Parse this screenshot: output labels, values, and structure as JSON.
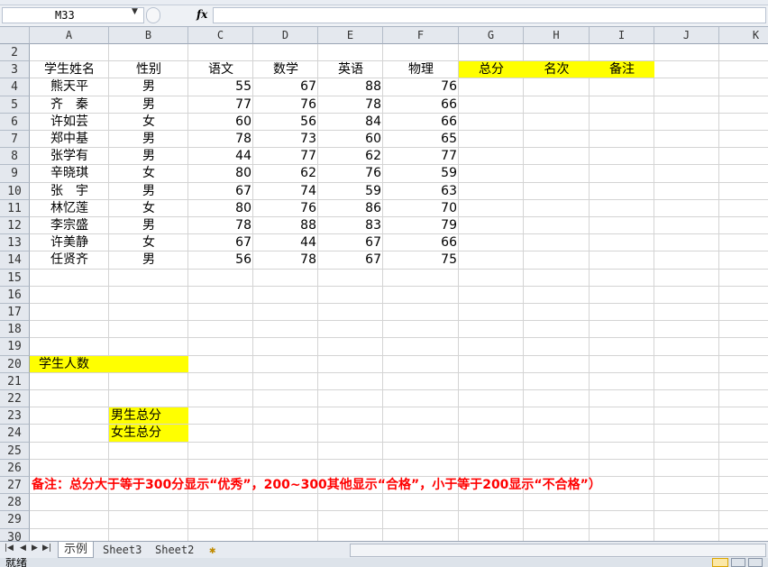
{
  "formula_bar": {
    "name_box": "M33",
    "fx_label": "fx",
    "formula": ""
  },
  "columns": [
    "A",
    "B",
    "C",
    "D",
    "E",
    "F",
    "G",
    "H",
    "I",
    "J",
    "K"
  ],
  "row_numbers": [
    "2",
    "3",
    "4",
    "5",
    "6",
    "7",
    "8",
    "9",
    "10",
    "11",
    "12",
    "13",
    "14",
    "15",
    "16",
    "17",
    "18",
    "19",
    "20",
    "21",
    "22",
    "23",
    "24",
    "25",
    "26",
    "27",
    "28",
    "29",
    "30"
  ],
  "highlight_color": "#FFFF00",
  "note_color": "#FF0000",
  "cells": [
    {
      "col": "A",
      "row": 3,
      "text": "学生姓名"
    },
    {
      "col": "B",
      "row": 3,
      "text": "性别"
    },
    {
      "col": "C",
      "row": 3,
      "text": "语文"
    },
    {
      "col": "D",
      "row": 3,
      "text": "数学"
    },
    {
      "col": "E",
      "row": 3,
      "text": "英语"
    },
    {
      "col": "F",
      "row": 3,
      "text": "物理"
    },
    {
      "col": "G",
      "row": 3,
      "text": "总分",
      "fill": true
    },
    {
      "col": "H",
      "row": 3,
      "text": "名次",
      "fill": true
    },
    {
      "col": "I",
      "row": 3,
      "text": "备注",
      "fill": true
    },
    {
      "col": "A",
      "row": 4,
      "text": "熊天平"
    },
    {
      "col": "B",
      "row": 4,
      "text": "男"
    },
    {
      "col": "C",
      "row": 4,
      "text": "55",
      "num": true
    },
    {
      "col": "D",
      "row": 4,
      "text": "67",
      "num": true
    },
    {
      "col": "E",
      "row": 4,
      "text": "88",
      "num": true
    },
    {
      "col": "F",
      "row": 4,
      "text": "76",
      "num": true
    },
    {
      "col": "A",
      "row": 5,
      "text": "齐　秦"
    },
    {
      "col": "B",
      "row": 5,
      "text": "男"
    },
    {
      "col": "C",
      "row": 5,
      "text": "77",
      "num": true
    },
    {
      "col": "D",
      "row": 5,
      "text": "76",
      "num": true
    },
    {
      "col": "E",
      "row": 5,
      "text": "78",
      "num": true
    },
    {
      "col": "F",
      "row": 5,
      "text": "66",
      "num": true
    },
    {
      "col": "A",
      "row": 6,
      "text": "许如芸"
    },
    {
      "col": "B",
      "row": 6,
      "text": "女"
    },
    {
      "col": "C",
      "row": 6,
      "text": "60",
      "num": true
    },
    {
      "col": "D",
      "row": 6,
      "text": "56",
      "num": true
    },
    {
      "col": "E",
      "row": 6,
      "text": "84",
      "num": true
    },
    {
      "col": "F",
      "row": 6,
      "text": "66",
      "num": true
    },
    {
      "col": "A",
      "row": 7,
      "text": "郑中基"
    },
    {
      "col": "B",
      "row": 7,
      "text": "男"
    },
    {
      "col": "C",
      "row": 7,
      "text": "78",
      "num": true
    },
    {
      "col": "D",
      "row": 7,
      "text": "73",
      "num": true
    },
    {
      "col": "E",
      "row": 7,
      "text": "60",
      "num": true
    },
    {
      "col": "F",
      "row": 7,
      "text": "65",
      "num": true
    },
    {
      "col": "A",
      "row": 8,
      "text": "张学有"
    },
    {
      "col": "B",
      "row": 8,
      "text": "男"
    },
    {
      "col": "C",
      "row": 8,
      "text": "44",
      "num": true
    },
    {
      "col": "D",
      "row": 8,
      "text": "77",
      "num": true
    },
    {
      "col": "E",
      "row": 8,
      "text": "62",
      "num": true
    },
    {
      "col": "F",
      "row": 8,
      "text": "77",
      "num": true
    },
    {
      "col": "A",
      "row": 9,
      "text": "辛晓琪"
    },
    {
      "col": "B",
      "row": 9,
      "text": "女"
    },
    {
      "col": "C",
      "row": 9,
      "text": "80",
      "num": true
    },
    {
      "col": "D",
      "row": 9,
      "text": "62",
      "num": true
    },
    {
      "col": "E",
      "row": 9,
      "text": "76",
      "num": true
    },
    {
      "col": "F",
      "row": 9,
      "text": "59",
      "num": true
    },
    {
      "col": "A",
      "row": 10,
      "text": "张　宇"
    },
    {
      "col": "B",
      "row": 10,
      "text": "男"
    },
    {
      "col": "C",
      "row": 10,
      "text": "67",
      "num": true
    },
    {
      "col": "D",
      "row": 10,
      "text": "74",
      "num": true
    },
    {
      "col": "E",
      "row": 10,
      "text": "59",
      "num": true
    },
    {
      "col": "F",
      "row": 10,
      "text": "63",
      "num": true
    },
    {
      "col": "A",
      "row": 11,
      "text": "林忆莲"
    },
    {
      "col": "B",
      "row": 11,
      "text": "女"
    },
    {
      "col": "C",
      "row": 11,
      "text": "80",
      "num": true
    },
    {
      "col": "D",
      "row": 11,
      "text": "76",
      "num": true
    },
    {
      "col": "E",
      "row": 11,
      "text": "86",
      "num": true
    },
    {
      "col": "F",
      "row": 11,
      "text": "70",
      "num": true
    },
    {
      "col": "A",
      "row": 12,
      "text": "李宗盛"
    },
    {
      "col": "B",
      "row": 12,
      "text": "男"
    },
    {
      "col": "C",
      "row": 12,
      "text": "78",
      "num": true
    },
    {
      "col": "D",
      "row": 12,
      "text": "88",
      "num": true
    },
    {
      "col": "E",
      "row": 12,
      "text": "83",
      "num": true
    },
    {
      "col": "F",
      "row": 12,
      "text": "79",
      "num": true
    },
    {
      "col": "A",
      "row": 13,
      "text": "许美静"
    },
    {
      "col": "B",
      "row": 13,
      "text": "女"
    },
    {
      "col": "C",
      "row": 13,
      "text": "67",
      "num": true
    },
    {
      "col": "D",
      "row": 13,
      "text": "44",
      "num": true
    },
    {
      "col": "E",
      "row": 13,
      "text": "67",
      "num": true
    },
    {
      "col": "F",
      "row": 13,
      "text": "66",
      "num": true
    },
    {
      "col": "A",
      "row": 14,
      "text": "任贤齐"
    },
    {
      "col": "B",
      "row": 14,
      "text": "男"
    },
    {
      "col": "C",
      "row": 14,
      "text": "56",
      "num": true
    },
    {
      "col": "D",
      "row": 14,
      "text": "78",
      "num": true
    },
    {
      "col": "E",
      "row": 14,
      "text": "67",
      "num": true
    },
    {
      "col": "F",
      "row": 14,
      "text": "75",
      "num": true
    },
    {
      "col": "A",
      "row": 20,
      "text": "学生人数",
      "fill": true,
      "span": 2,
      "left": true
    },
    {
      "col": "B",
      "row": 23,
      "text": "男生总分",
      "fill": true,
      "left": true
    },
    {
      "col": "B",
      "row": 24,
      "text": "女生总分",
      "fill": true,
      "left": true
    },
    {
      "col": "A",
      "row": 27,
      "text": "备注：总分大于等于300分显示“优秀”，200~300其他显示“合格”，小于等于200显示“不合格”）",
      "note": true,
      "left": true
    }
  ],
  "sheet_tabs": [
    "示例",
    "Sheet3",
    "Sheet2"
  ],
  "status": {
    "text": "就绪"
  }
}
